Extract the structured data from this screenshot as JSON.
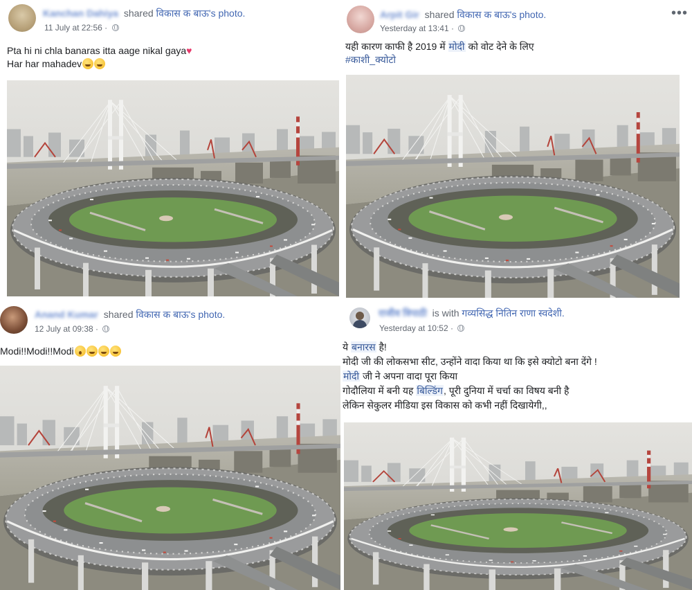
{
  "posts": [
    {
      "author_blurred": "Kanchan Dahiya",
      "action": "shared",
      "shared_from": "विकास क बाऊ's photo.",
      "timestamp": "11 July at 22:56 ·",
      "text_lines": [
        "Pta hi ni chla banaras itta aage nikal gaya",
        "Har har mahadev"
      ],
      "heart": "♥"
    },
    {
      "author_blurred": "Arpit Gir",
      "action": "shared",
      "shared_from": "विकास क बाऊ's photo.",
      "timestamp": "Yesterday at 13:41 ·",
      "text_line1_pre": "यही कारण काफी है 2019 में ",
      "text_line1_hl": "मोदी",
      "text_line1_post": " को वोट देने के लिए",
      "hashtag": "#काशी_क्योटो",
      "more_label": "•••"
    },
    {
      "author_blurred": "Anand Kumar",
      "action": "shared",
      "shared_from": "विकास क बाऊ's photo.",
      "timestamp": "12 July at 09:38 ·",
      "text": "Modi!!Modi!!Modi"
    },
    {
      "author_blurred": "राजीव त्रिपाठी",
      "action": "is with",
      "with_name": "गव्यसिद्ध नितिन राणा स्वदेशी.",
      "timestamp": "Yesterday at 10:52 ·",
      "line1_pre": "ये ",
      "line1_hl": "बनारस",
      "line1_post": " है!",
      "line2": "मोदी जी की लोकसभा सीट, उन्होंने वादा किया था कि इसे क्योटो बना देंगे !",
      "line3_hl": "मोदी",
      "line3_post": " जी ने अपना वादा पूरा किया",
      "line4_pre": "गोदौलिया में बनी यह ",
      "line4_hl": "बिल्डिंग",
      "line4_post": ", पूरी दुनिया में चर्चा का विषय बनी है",
      "line5": "लेकिन सेकुलर मीडिया इस विकास को कभी नहीं दिखायेगी,,"
    }
  ],
  "colors": {
    "link": "#4267b2",
    "meta": "#616770",
    "highlight_bg": "#edf2fa",
    "sky": "#dcdcda",
    "road": "#8a8c8e",
    "grass": "#6f9a52"
  }
}
